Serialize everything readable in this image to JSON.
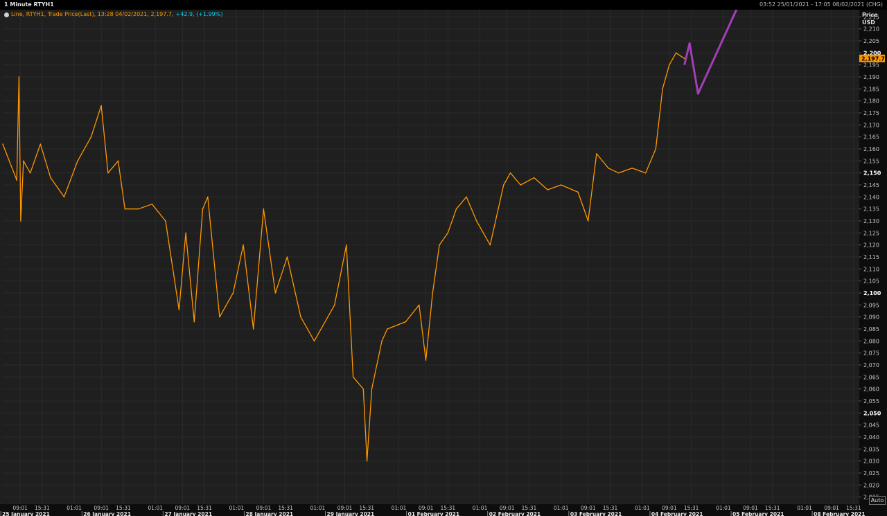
{
  "header": {
    "title": "1 Minute RTYH1",
    "range": "03:52 25/01/2021 - 17:05 08/02/2021 (CHG)"
  },
  "legend": {
    "text": "Line, RTYH1, Trade Price(Last),  13:28 04/02/2021, 2,197.7, ",
    "change": "+42.9,  (+1.99%)"
  },
  "axis": {
    "price_label": "Price",
    "currency_label": "USD",
    "auto_label": "Auto",
    "current_price_label": "2,197.7"
  },
  "colors": {
    "price_line": "#ff9800",
    "forecast_line": "#a13fb8",
    "background": "#1f1f1f",
    "grid": "#2b2b2b",
    "change": "#00d5ff"
  },
  "chart_data": {
    "type": "line",
    "series": [
      {
        "name": "RTYH1",
        "x": [
          "25/01 03:52",
          "25/01 08:00",
          "25/01 08:40",
          "25/01 09:10",
          "25/01 10:00",
          "25/01 12:00",
          "25/01 15:00",
          "25/01 18:00",
          "25/01 22:00",
          "26/01 02:00",
          "26/01 06:00",
          "26/01 09:00",
          "26/01 11:00",
          "26/01 14:00",
          "26/01 16:00",
          "26/01 20:00",
          "27/01 00:00",
          "27/01 04:00",
          "27/01 08:00",
          "27/01 10:00",
          "27/01 12:30",
          "27/01 15:00",
          "27/01 16:30",
          "27/01 20:00",
          "28/01 00:00",
          "28/01 03:00",
          "28/01 06:00",
          "28/01 09:00",
          "28/01 12:30",
          "28/01 16:00",
          "28/01 20:00",
          "29/01 00:00",
          "29/01 06:00",
          "29/01 09:30",
          "29/01 11:30",
          "29/01 14:30",
          "29/01 15:35",
          "29/01 17:00",
          "29/01 20:00",
          "30/01 00:00",
          "01/02 03:00",
          "01/02 07:00",
          "01/02 09:00",
          "01/02 11:00",
          "01/02 13:00",
          "01/02 15:30",
          "01/02 18:00",
          "01/02 21:00",
          "02/02 00:00",
          "02/02 04:00",
          "02/02 08:00",
          "02/02 10:00",
          "02/02 13:00",
          "02/02 17:00",
          "02/02 21:00",
          "03/02 01:00",
          "03/02 06:00",
          "03/02 09:00",
          "03/02 11:30",
          "03/02 15:00",
          "03/02 18:00",
          "03/02 22:00",
          "04/02 02:00",
          "04/02 05:00",
          "04/02 07:00",
          "04/02 09:00",
          "04/02 11:00",
          "04/02 13:28"
        ],
        "values": [
          2162,
          2147,
          2190,
          2130,
          2155,
          2150,
          2162,
          2148,
          2140,
          2155,
          2165,
          2178,
          2150,
          2155,
          2135,
          2135,
          2137,
          2130,
          2093,
          2125,
          2088,
          2135,
          2140,
          2090,
          2100,
          2120,
          2085,
          2135,
          2100,
          2115,
          2090,
          2080,
          2095,
          2120,
          2065,
          2060,
          2030,
          2060,
          2080,
          2085,
          2088,
          2095,
          2072,
          2100,
          2120,
          2125,
          2135,
          2140,
          2130,
          2120,
          2145,
          2150,
          2145,
          2148,
          2143,
          2145,
          2142,
          2130,
          2158,
          2152,
          2150,
          2152,
          2150,
          2160,
          2185,
          2195,
          2200,
          2197.7
        ]
      },
      {
        "name": "",
        "x": [
          "04/02 13:28",
          "04/02 15:00",
          "04/02 17:30",
          "05/02 12:00"
        ],
        "values": [
          2195,
          2204,
          2183,
          2240
        ]
      }
    ],
    "x_tick_labels": [
      "09:01",
      "15:31",
      "01:01",
      "09:01",
      "15:31",
      "01:01",
      "09:01",
      "15:31",
      "01:01",
      "09:01",
      "15:31",
      "01:01",
      "09:01",
      "15:31",
      "01:01",
      "09:01",
      "15:31",
      "01:01",
      "09:01",
      "15:31",
      "01:01",
      "09:01",
      "15:31",
      "01:01",
      "09:01",
      "15:31",
      "01:01",
      "09:01",
      "15:31",
      "01:01",
      "09:01",
      "15:31"
    ],
    "date_labels": [
      "25 January 2021",
      "26 January 2021",
      "27 January 2021",
      "28 January 2021",
      "29 January 2021",
      "01 February 2021",
      "02 February 2021",
      "03 February 2021",
      "04 February 2021",
      "05 February 2021",
      "08 February 2021"
    ],
    "y_tick_labels": [
      "2,015",
      "2,020",
      "2,025",
      "2,030",
      "2,035",
      "2,040",
      "2,045",
      "2,050",
      "2,055",
      "2,060",
      "2,065",
      "2,070",
      "2,075",
      "2,080",
      "2,085",
      "2,090",
      "2,095",
      "2,100",
      "2,105",
      "2,110",
      "2,115",
      "2,120",
      "2,125",
      "2,130",
      "2,135",
      "2,140",
      "2,145",
      "2,150",
      "2,155",
      "2,160",
      "2,165",
      "2,170",
      "2,175",
      "2,180",
      "2,185",
      "2,190",
      "2,195",
      "2,200",
      "2,205",
      "2,210",
      "2,215"
    ],
    "y_bold_ticks": [
      "2,050",
      "2,100",
      "2,150",
      "2,200"
    ],
    "ylim": [
      2012,
      2218
    ],
    "grid": true
  }
}
